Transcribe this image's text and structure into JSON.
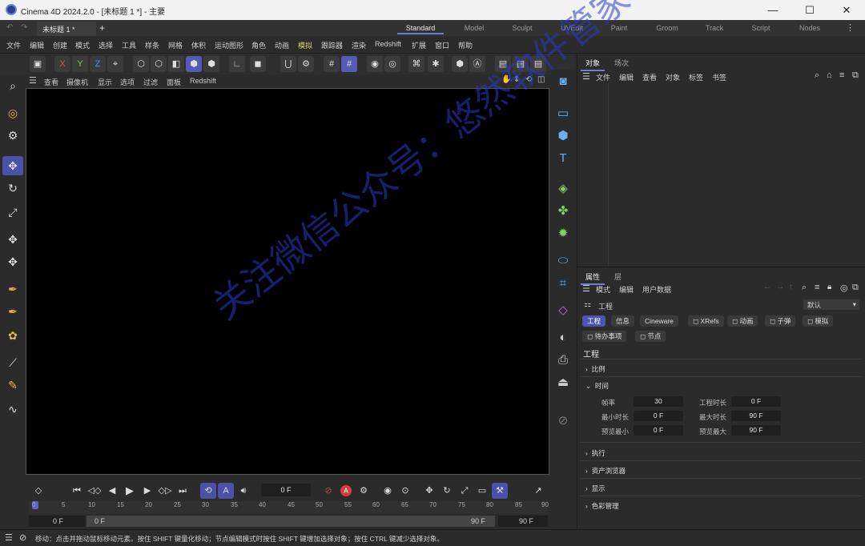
{
  "window": {
    "title": "Cinema 4D 2024.2.0 - [未标题 1 *] - 主要",
    "minimize": "—",
    "maximize": "☐",
    "close": "✕"
  },
  "tabs": {
    "doc": "未标题 1 *",
    "add": "+",
    "layouts": [
      "Standard",
      "Model",
      "Sculpt",
      "UVEdit",
      "Paint",
      "Groom",
      "Track",
      "Script",
      "Nodes"
    ],
    "active_layout": "Standard"
  },
  "menu": [
    "文件",
    "编辑",
    "创建",
    "模式",
    "选择",
    "工具",
    "样条",
    "网格",
    "体积",
    "运动图形",
    "角色",
    "动画",
    "模拟",
    "跟踪器",
    "渲染",
    "Redshift",
    "扩展",
    "窗口",
    "帮助"
  ],
  "viewport_menu": [
    "查看",
    "摄像机",
    "显示",
    "选项",
    "过滤",
    "面板",
    "Redshift"
  ],
  "object_panel": {
    "tabs": [
      "对象",
      "场次"
    ],
    "menu": [
      "文件",
      "编辑",
      "查看",
      "对象",
      "标签",
      "书签"
    ]
  },
  "attr_panel": {
    "tabs": [
      "属性",
      "层"
    ],
    "menu": [
      "模式",
      "编辑",
      "用户数据"
    ],
    "header": "工程",
    "preset": "默认",
    "chips_row1": [
      "工程",
      "信息",
      "Cineware",
      "XRefs",
      "动画",
      "子弹",
      "模拟"
    ],
    "chips_row2": [
      "待办事项",
      "节点"
    ],
    "title": "工程",
    "sections": [
      "比例",
      "时间",
      "执行",
      "资产浏览器",
      "显示",
      "色彩管理"
    ],
    "time": {
      "fps_label": "帧率",
      "fps": "30",
      "proj_len_label": "工程时长",
      "proj_len": "0 F",
      "min_len_label": "最小时长",
      "min_len": "0 F",
      "max_len_label": "最大时长",
      "max_len": "90 F",
      "prev_min_label": "预览最小",
      "prev_min": "0 F",
      "prev_max_label": "预览最大",
      "prev_max": "90 F"
    }
  },
  "timeline": {
    "current_frame": "0 F",
    "ticks": [
      "0",
      "5",
      "10",
      "15",
      "20",
      "25",
      "30",
      "35",
      "40",
      "45",
      "50",
      "55",
      "60",
      "65",
      "70",
      "75",
      "80",
      "85",
      "90"
    ],
    "range_start": "0 F",
    "range_start2": "0 F",
    "range_end": "90 F",
    "range_end2": "90 F"
  },
  "status": "移动：点击并拖动鼠标移动元素。按住 SHIFT 键量化移动；节点编辑模式时按住 SHIFT 键增加选择对象；按住 CTRL 键减少选择对象。",
  "watermark": "关注微信公众号：悠然软件管家",
  "colors": {
    "accent": "#5a63c8",
    "bg": "#2b2b2b",
    "viewport": "#000000"
  }
}
